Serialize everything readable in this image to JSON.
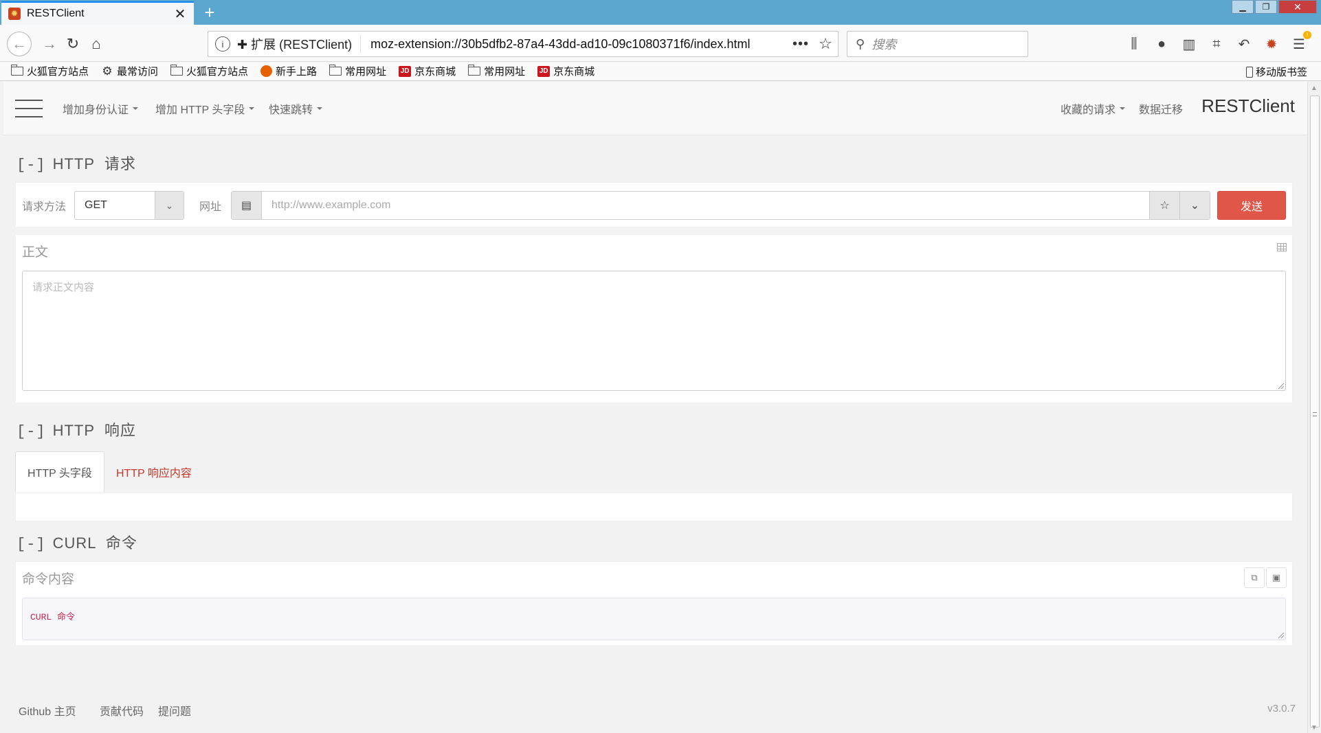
{
  "browser": {
    "tab_title": "RESTClient",
    "tab_close": "✕",
    "new_tab": "+",
    "url_extension_label": "扩展 (RESTClient)",
    "url": "moz-extension://30b5dfb2-87a4-43dd-ad10-09c1080371f6/index.html",
    "search_placeholder": "搜索",
    "bookmarks": [
      {
        "label": "火狐官方站点",
        "icon": "folder-icon"
      },
      {
        "label": "最常访问",
        "icon": "gear-icon"
      },
      {
        "label": "火狐官方站点",
        "icon": "folder-icon"
      },
      {
        "label": "新手上路",
        "icon": "firefox-icon"
      },
      {
        "label": "常用网址",
        "icon": "folder-icon"
      },
      {
        "label": "京东商城",
        "icon": "jd-icon"
      },
      {
        "label": "常用网址",
        "icon": "folder-icon"
      },
      {
        "label": "京东商城",
        "icon": "jd-icon"
      }
    ],
    "mobile_bookmarks": "移动版书签"
  },
  "header": {
    "nav_auth": "增加身份认证",
    "nav_headers": "增加 HTTP 头字段",
    "nav_jump": "快速跳转",
    "nav_favorites": "收藏的请求",
    "nav_migrate": "数据迁移",
    "brand": "RESTClient"
  },
  "request": {
    "toggle": "[-]",
    "title": "HTTP  请求",
    "method_label": "请求方法",
    "method_value": "GET",
    "url_label": "网址",
    "url_placeholder": "http://www.example.com",
    "send_label": "发送",
    "body_title": "正文",
    "body_placeholder": "请求正文内容"
  },
  "response": {
    "toggle": "[-]",
    "title": "HTTP  响应",
    "tabs": [
      {
        "label": "HTTP 头字段",
        "active": true
      },
      {
        "label": "HTTP 响应内容",
        "active": false
      }
    ]
  },
  "curl": {
    "toggle": "[-]",
    "title": "CURL  命令",
    "panel_title": "命令内容",
    "command": "CURL 命令"
  },
  "footer": {
    "github": "Github 主页",
    "contribute": "贡献代码",
    "issues": "提问题",
    "version": "v3.0.7"
  },
  "colors": {
    "send_button": "#e0574a",
    "link_red": "#c0392b",
    "titlebar": "#5ba7d0"
  }
}
